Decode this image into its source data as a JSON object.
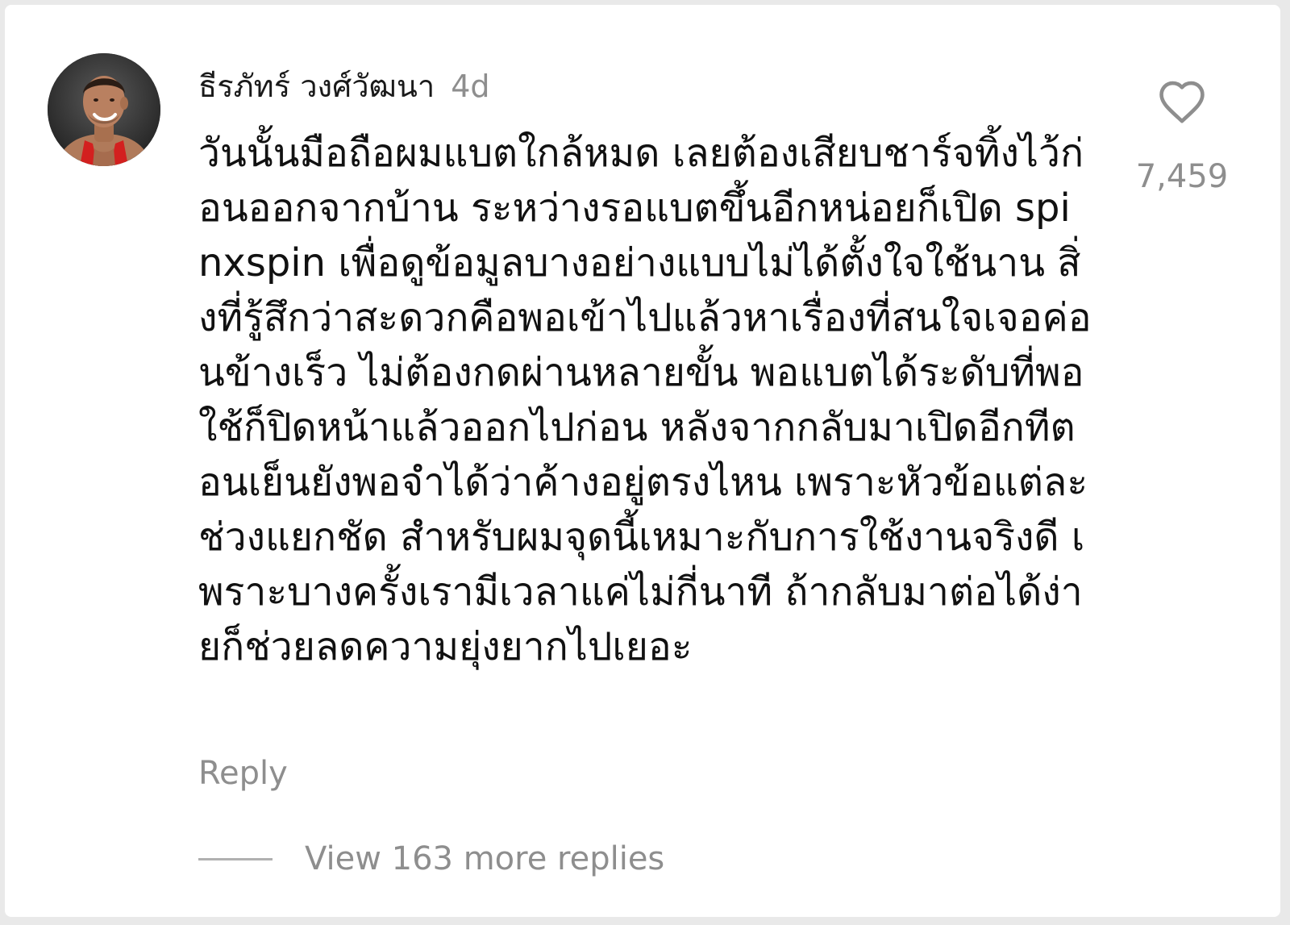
{
  "comment": {
    "username": "ธีรภัทร์ วงศ์วัฒนา",
    "time": "4d",
    "text": "วันนั้นมือถือผมแบตใกล้หมด เลยต้องเสียบชาร์จทิ้งไว้ก่อนออกจากบ้าน ระหว่างรอแบตขึ้นอีกหน่อยก็เปิด spinxspin เพื่อดูข้อมูลบางอย่างแบบไม่ได้ตั้งใจใช้นาน สิ่งที่รู้สึกว่าสะดวกคือพอเข้าไปแล้วหาเรื่องที่สนใจเจอค่อนข้างเร็ว ไม่ต้องกดผ่านหลายขั้น พอแบตได้ระดับที่พอใช้ก็ปิดหน้าแล้วออกไปก่อน หลังจากกลับมาเปิดอีกทีตอนเย็นยังพอจำได้ว่าค้างอยู่ตรงไหน เพราะหัวข้อแต่ละช่วงแยกชัด สำหรับผมจุดนี้เหมาะกับการใช้งานจริงดี เพราะบางครั้งเรามีเวลาแค่ไม่กี่นาที ถ้ากลับมาต่อได้ง่ายก็ช่วยลดความยุ่งยากไปเยอะ",
    "like_count": "7,459",
    "like_icon": "heart-outline-icon",
    "reply_label": "Reply",
    "view_replies_label": "View 163 more replies"
  },
  "colors": {
    "text_primary": "#111111",
    "text_secondary": "#8e8e8e",
    "background": "#ffffff"
  }
}
